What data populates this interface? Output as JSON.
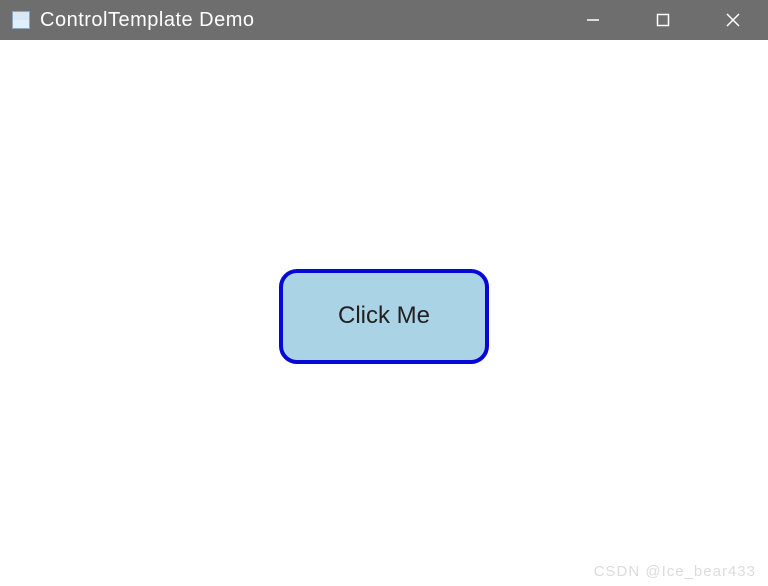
{
  "window": {
    "title": "ControlTemplate Demo"
  },
  "button": {
    "label": "Click Me"
  },
  "watermark": {
    "text": "CSDN @Ice_bear433"
  }
}
